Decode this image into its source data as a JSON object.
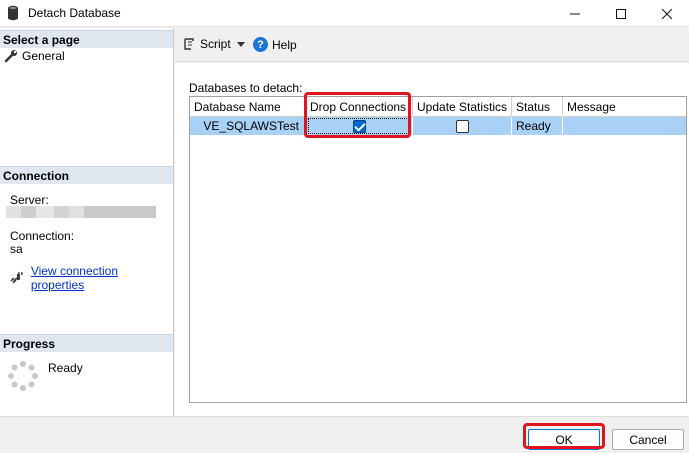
{
  "window": {
    "title": "Detach Database"
  },
  "left": {
    "select_page_header": "Select a page",
    "pages": [
      {
        "label": "General"
      }
    ],
    "connection_header": "Connection",
    "server_label": "Server:",
    "connection_label": "Connection:",
    "connection_value": "sa",
    "view_connection_link": "View connection properties",
    "progress_header": "Progress",
    "progress_status": "Ready"
  },
  "toolbar": {
    "script_label": "Script",
    "help_label": "Help"
  },
  "main": {
    "databases_label": "Databases to detach:",
    "columns": [
      "Database Name",
      "Drop Connections",
      "Update Statistics",
      "Status",
      "Message"
    ],
    "rows": [
      {
        "database_name": "VE_SQLAWSTest",
        "drop_connections": true,
        "update_statistics": false,
        "status": "Ready",
        "message": ""
      }
    ]
  },
  "buttons": {
    "ok_label": "OK",
    "cancel_label": "Cancel"
  },
  "colors": {
    "selection": "#a9d0f5",
    "highlight": "#e0141e",
    "section_header": "#dfe6ef",
    "link": "#0033cc"
  }
}
